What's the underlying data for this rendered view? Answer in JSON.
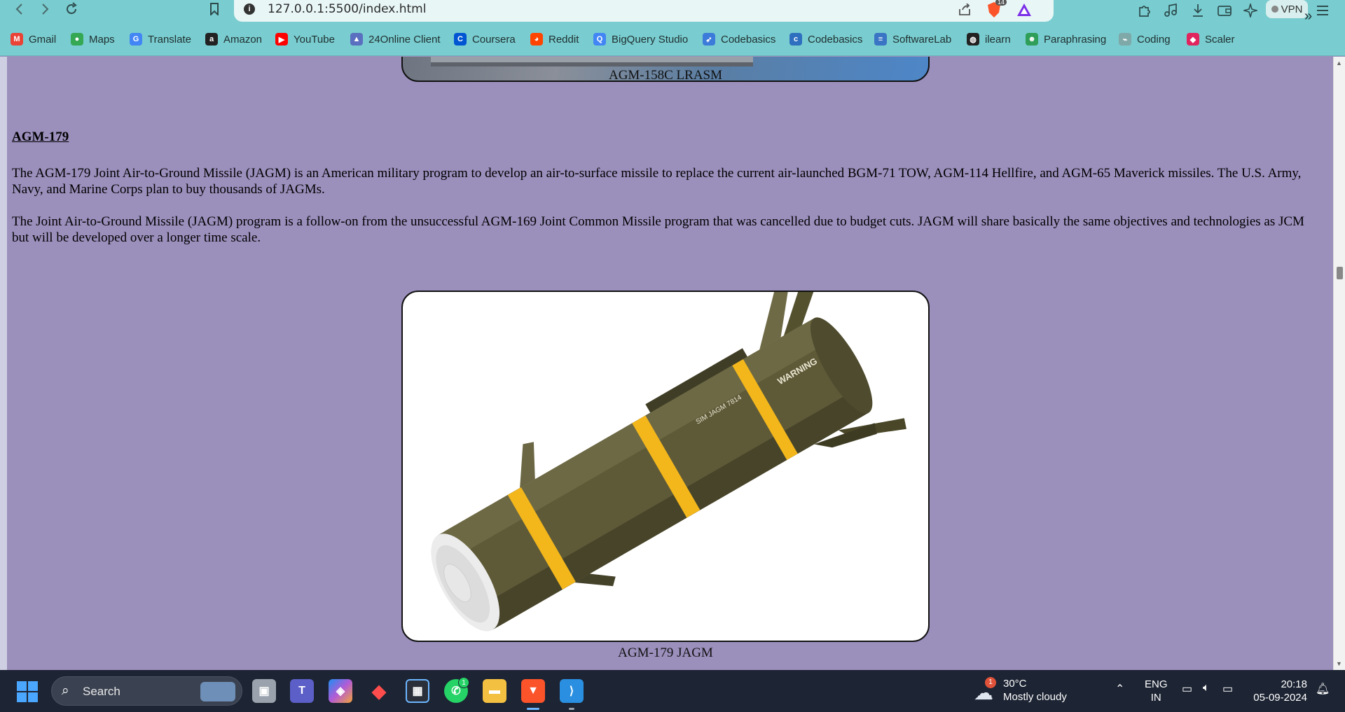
{
  "browser": {
    "url": "127.0.0.1:5500/index.html",
    "shield_badge": "14",
    "vpn_label": "VPN",
    "bookmarks": [
      {
        "label": "Gmail",
        "icon": "gmail-icon",
        "color": "#ea4335",
        "glyph": "M"
      },
      {
        "label": "Maps",
        "icon": "maps-icon",
        "color": "#34a853",
        "glyph": "●"
      },
      {
        "label": "Translate",
        "icon": "translate-icon",
        "color": "#4285f4",
        "glyph": "G"
      },
      {
        "label": "Amazon",
        "icon": "amazon-icon",
        "color": "#222222",
        "glyph": "a"
      },
      {
        "label": "YouTube",
        "icon": "youtube-icon",
        "color": "#ff0000",
        "glyph": "▶"
      },
      {
        "label": "24Online Client",
        "icon": "24online-icon",
        "color": "#5a6fbf",
        "glyph": "▲"
      },
      {
        "label": "Coursera",
        "icon": "coursera-icon",
        "color": "#0056d2",
        "glyph": "C"
      },
      {
        "label": "Reddit",
        "icon": "reddit-icon",
        "color": "#ff4500",
        "glyph": "◕"
      },
      {
        "label": "BigQuery Studio",
        "icon": "bigquery-icon",
        "color": "#4285f4",
        "glyph": "Q"
      },
      {
        "label": "Codebasics",
        "icon": "rocket-icon",
        "color": "#3c7bd9",
        "glyph": "➶"
      },
      {
        "label": "Codebasics",
        "icon": "codebasics-icon",
        "color": "#2f6fbf",
        "glyph": "c"
      },
      {
        "label": "SoftwareLab",
        "icon": "softwarelab-icon",
        "color": "#3a74c4",
        "glyph": "≡"
      },
      {
        "label": "ilearn",
        "icon": "ilearn-icon",
        "color": "#222222",
        "glyph": "◍"
      },
      {
        "label": "Paraphrasing",
        "icon": "paraphrasing-icon",
        "color": "#2e9e58",
        "glyph": "☻"
      },
      {
        "label": "Coding",
        "icon": "coding-icon",
        "color": "#7fa8a8",
        "glyph": "⌁"
      },
      {
        "label": "Scaler",
        "icon": "scaler-icon",
        "color": "#e0245e",
        "glyph": "◆"
      }
    ]
  },
  "page": {
    "prev_caption": "AGM-158C LRASM",
    "section_title": "AGM-179",
    "paragraphs": [
      "The AGM-179 Joint Air-to-Ground Missile (JAGM) is an American military program to develop an air-to-surface missile to replace the current air-launched BGM-71 TOW, AGM-114 Hellfire, and AGM-65 Maverick missiles. The U.S. Army, Navy, and Marine Corps plan to buy thousands of JAGMs.",
      "The Joint Air-to-Ground Missile (JAGM) program is a follow-on from the unsuccessful AGM-169 Joint Common Missile program that was cancelled due to budget cuts. JAGM will share basically the same objectives and technologies as JCM but will be developed over a longer time scale."
    ],
    "figure_caption": "AGM-179 JAGM",
    "missile_markings": {
      "warning": "WARNING",
      "serial": "SIM JAGM 7814"
    }
  },
  "taskbar": {
    "search_label": "Search",
    "whatsapp_badge": "1",
    "weather_badge": "1",
    "weather_temp": "30°C",
    "weather_desc": "Mostly cloudy",
    "lang_top": "ENG",
    "lang_bottom": "IN",
    "time": "20:18",
    "date": "05-09-2024"
  }
}
